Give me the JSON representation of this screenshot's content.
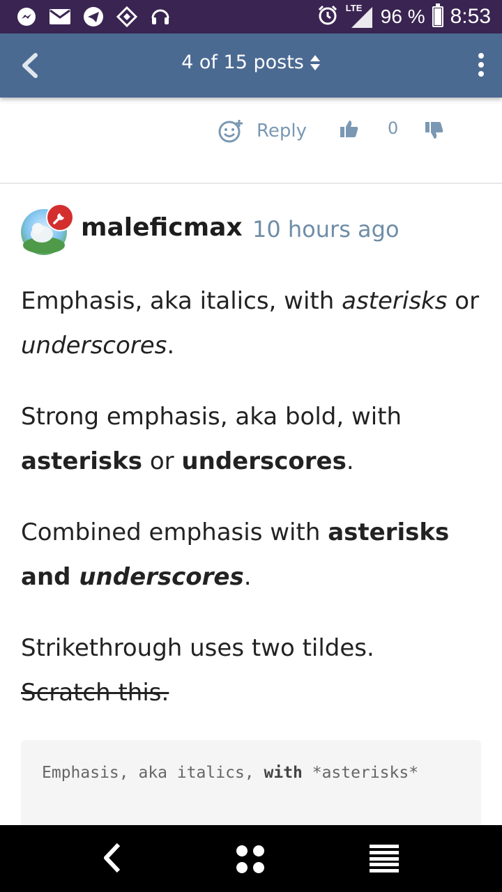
{
  "status_bar": {
    "battery": "96 %",
    "time": "8:53",
    "network": "LTE",
    "icons": [
      "messenger-icon",
      "mail-icon",
      "telegram-icon",
      "sync-icon",
      "headset-icon",
      "alarm-icon",
      "signal-icon",
      "battery-icon"
    ]
  },
  "app_bar": {
    "title": "4 of 15 posts"
  },
  "post_actions": {
    "reply_label": "Reply",
    "vote_count": "0"
  },
  "post": {
    "username": "maleficmax",
    "time_ago": "10 hours ago",
    "p1": {
      "t1": "Emphasis, aka italics, with ",
      "em1": "asterisks",
      "t2": " or ",
      "em2": "underscores",
      "t3": "."
    },
    "p2": {
      "t1": "Strong emphasis, aka bold, with ",
      "b1": "asterisks",
      "t2": " or ",
      "b2": "underscores",
      "t3": "."
    },
    "p3": {
      "t1": "Combined emphasis with ",
      "b1": "asterisks and ",
      "bi": "underscores",
      "t2": "."
    },
    "p4": {
      "t1": "Strikethrough uses two tildes.",
      "strike": "Scratch this."
    },
    "code": {
      "t1": "Emphasis, aka italics, ",
      "kw": "with",
      "t2": " *asterisks*"
    }
  },
  "colors": {
    "status_bar": "#3a2552",
    "app_bar": "#4b6a92",
    "accent_text": "#6f8da7",
    "badge": "#d32f2f"
  }
}
